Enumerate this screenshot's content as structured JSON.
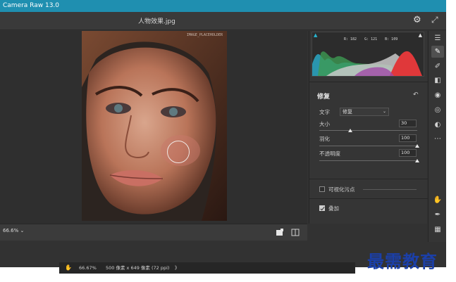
{
  "app": {
    "title": "Camera Raw 13.0"
  },
  "file": {
    "name": "人物效果.jpg"
  },
  "photo": {
    "tag": "IMAGE_PLACEHOLDER"
  },
  "histogram": {
    "r_label": "R: 182",
    "g_label": "G: 121",
    "b_label": "B: 109"
  },
  "panel": {
    "title": "修复",
    "type_label": "文字",
    "type_value": "修复",
    "size_label": "大小",
    "size_value": "30",
    "size_level": 0.3,
    "feather_label": "羽化",
    "feather_value": "100",
    "feather_level": 1.0,
    "opacity_label": "不透明度",
    "opacity_value": "100",
    "opacity_level": 1.0,
    "visualize_label": "可视化污点",
    "visualize_checked": false,
    "overlay_label": "叠加",
    "overlay_checked": true
  },
  "bottom": {
    "zoom": "66.6%"
  },
  "status": {
    "zoom": "66.67%",
    "size": "500 像素 x 649 像素 (72 ppi)",
    "more": "》"
  },
  "watermark": "最需教育",
  "colors": {
    "titlebar": "#1f8fb0",
    "accent": "#27b5d0",
    "watermark": "#1b3fa8"
  },
  "tools": [
    "sliders-icon",
    "crop-icon",
    "healing-brush-icon",
    "adjust-brush-icon",
    "gradient-icon",
    "radial-icon",
    "redeye-icon",
    "presets-icon",
    "more-icon"
  ]
}
